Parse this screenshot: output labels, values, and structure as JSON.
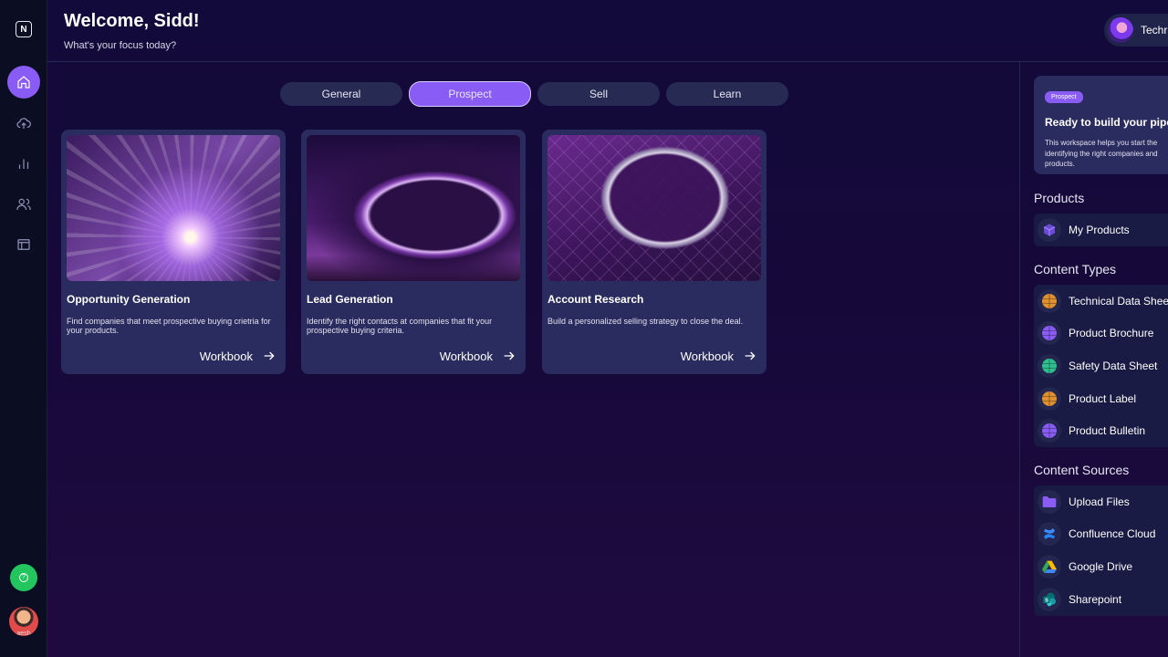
{
  "app": {
    "logo_letter": "N"
  },
  "header": {
    "welcome": "Welcome, Sidd!",
    "subtitle": "What's your focus today?",
    "profile_name": "Techr"
  },
  "sidebar": {
    "items": [
      {
        "icon": "home-icon",
        "active": true
      },
      {
        "icon": "upload-cloud-icon",
        "active": false
      },
      {
        "icon": "bar-chart-icon",
        "active": false
      },
      {
        "icon": "users-icon",
        "active": false
      },
      {
        "icon": "window-icon",
        "active": false
      }
    ],
    "help_icon": "?",
    "user_label": "aesh"
  },
  "tabs": [
    {
      "label": "General",
      "active": false
    },
    {
      "label": "Prospect",
      "active": true
    },
    {
      "label": "Sell",
      "active": false
    },
    {
      "label": "Learn",
      "active": false
    }
  ],
  "cards": [
    {
      "title": "Opportunity Generation",
      "description": "Find companies that meet prospective buying crietria for your products.",
      "link": "Workbook"
    },
    {
      "title": "Lead Generation",
      "description": "Identify the right contacts at companies that fit your prospective buying criteria.",
      "link": "Workbook"
    },
    {
      "title": "Account Research",
      "description": "Build a personalized selling strategy to close the deal.",
      "link": "Workbook"
    }
  ],
  "promo": {
    "badge": "Prospect",
    "title": "Ready to build your pipe",
    "text": "This workspace helps you start the identifying the right companies and products."
  },
  "products": {
    "title": "Products",
    "items": [
      {
        "label": "My Products",
        "icon": "cube-icon"
      }
    ]
  },
  "content_types": {
    "title": "Content Types",
    "items": [
      {
        "label": "Technical Data Shee",
        "icon": "globe-icon",
        "color": "#e0902f"
      },
      {
        "label": "Product Brochure",
        "icon": "globe-icon",
        "color": "#8a5cf6"
      },
      {
        "label": "Safety Data Sheet",
        "icon": "globe-icon",
        "color": "#2fbf8f"
      },
      {
        "label": "Product Label",
        "icon": "globe-icon",
        "color": "#e0902f"
      },
      {
        "label": "Product Bulletin",
        "icon": "globe-icon",
        "color": "#8a5cf6"
      }
    ]
  },
  "content_sources": {
    "title": "Content Sources",
    "items": [
      {
        "label": "Upload Files",
        "icon": "folder-icon"
      },
      {
        "label": "Confluence Cloud",
        "icon": "confluence-icon"
      },
      {
        "label": "Google Drive",
        "icon": "google-drive-icon"
      },
      {
        "label": "Sharepoint",
        "icon": "sharepoint-icon"
      }
    ]
  }
}
